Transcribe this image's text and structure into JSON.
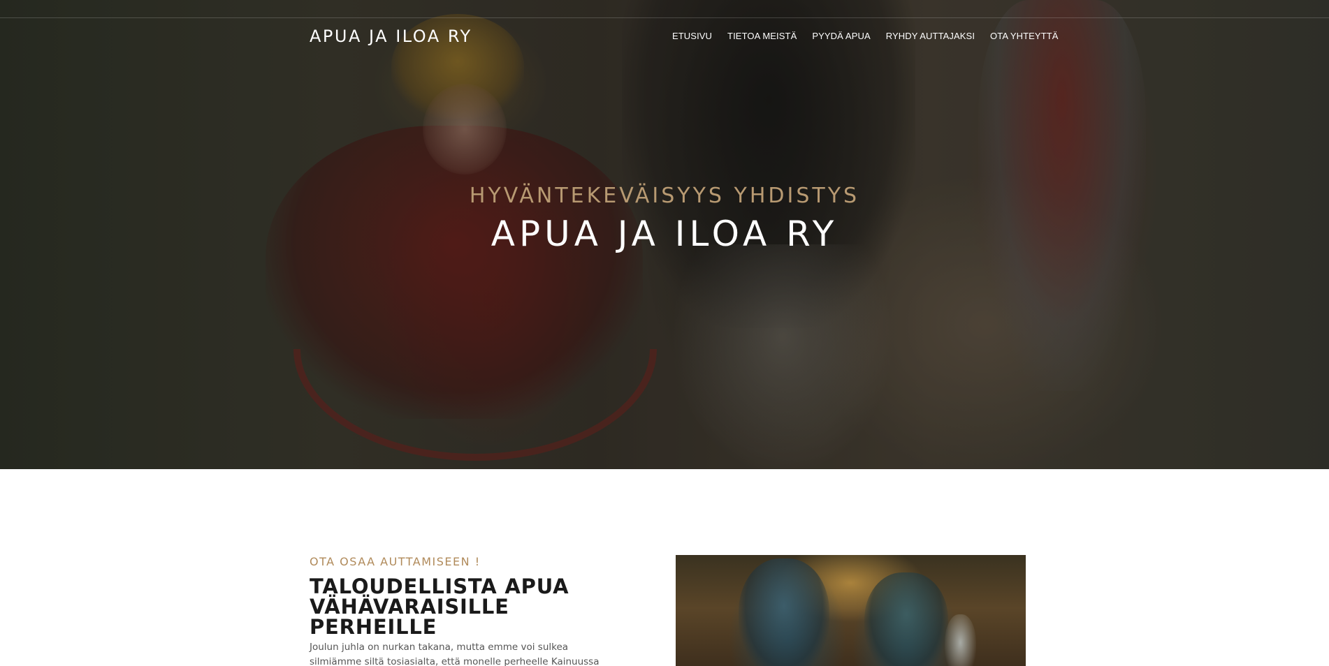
{
  "site": {
    "logo": "APUA JA ILOA RY"
  },
  "nav": {
    "items": [
      {
        "label": "ETUSIVU"
      },
      {
        "label": "TIETOA MEISTÄ"
      },
      {
        "label": "PYYDÄ APUA"
      },
      {
        "label": "RYHDY AUTTAJAKSI"
      },
      {
        "label": "OTA YHTEYTTÄ"
      }
    ]
  },
  "hero": {
    "subtitle": "HYVÄNTEKEVÄISYYS YHDISTYS",
    "title": "APUA JA ILOA RY"
  },
  "intro": {
    "kicker": "OTA OSAA AUTTAMISEEN !",
    "heading_line1": "TALOUDELLISTA APUA",
    "heading_line2": "VÄHÄVARAISILLE PERHEILLE",
    "body": "Joulun juhla on nurkan takana, mutta emme voi sulkea silmiämme siltä tosiasialta, että monelle perheelle Kainuussa tämä vuodenaika on kaikkea"
  },
  "colors": {
    "accent": "#b89a72",
    "kicker": "#b08a5a",
    "heading": "#1a1a1a",
    "body_text": "#555555"
  }
}
